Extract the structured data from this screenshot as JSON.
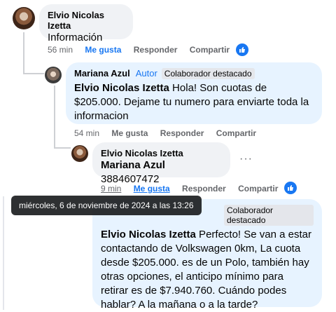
{
  "comments": [
    {
      "author": "Elvio Nicolas Izetta",
      "text": "Información",
      "time": "56 min",
      "like_label": "Me gusta",
      "reply_label": "Responder",
      "share_label": "Compartir"
    },
    {
      "author": "Mariana Azul",
      "role": "Autor",
      "badge": "Colaborador destacado",
      "mention": "Elvio Nicolas Izetta",
      "text": " Hola! Son cuotas de $205.000. Dejame tu numero para enviarte toda la informacion",
      "time": "54 min",
      "like_label": "Me gusta",
      "reply_label": "Responder",
      "share_label": "Compartir"
    },
    {
      "author": "Elvio Nicolas Izetta",
      "mention": "Mariana Azul",
      "text": " 3884607472",
      "time": "9 min",
      "like_label": "Me gusta",
      "reply_label": "Responder",
      "share_label": "Compartir"
    },
    {
      "badge": "Colaborador destacado",
      "mention": "Elvio Nicolas Izetta",
      "text": " Perfecto! Se van a estar contactando de Volkswagen 0km, La cuota desde $205.000. es de un Polo, también hay otras opciones, el anticipo mínimo para retirar es de $7.940.760. Cuándo podes hablar? A la mañana o a la tarde?"
    }
  ],
  "tooltip": "miércoles, 6 de noviembre de 2024 a las 13:26",
  "colors": {
    "accent": "#1877f2",
    "bubble_gray": "#f0f2f5",
    "bubble_blue": "#e7f3ff"
  },
  "icons": [
    "like-thumb-icon",
    "more-options-icon"
  ]
}
